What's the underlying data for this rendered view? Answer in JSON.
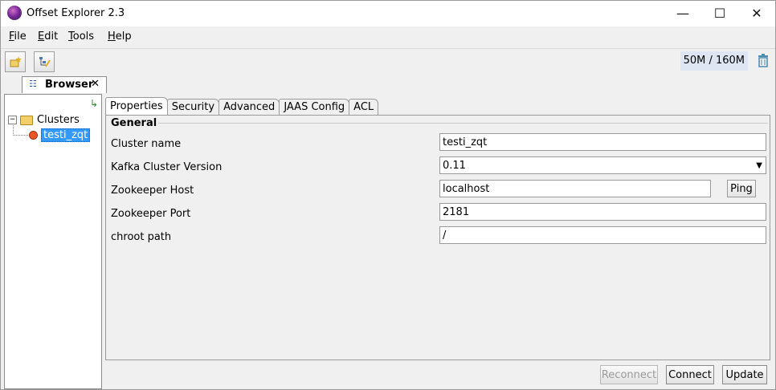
{
  "window": {
    "title": "Offset Explorer  2.3",
    "minimize": "—",
    "maximize": "☐",
    "close": "✕"
  },
  "menu": [
    {
      "mnemonic": "F",
      "rest": "ile"
    },
    {
      "mnemonic": "E",
      "rest": "dit"
    },
    {
      "mnemonic": "T",
      "rest": "ools"
    },
    {
      "mnemonic": "H",
      "rest": "elp"
    }
  ],
  "toolbar": {
    "memory": "50M / 160M",
    "icons": [
      "add-cluster-icon",
      "refresh-tree-icon",
      "trash-icon"
    ]
  },
  "browser_tab": {
    "label": "Browser",
    "close": "✕"
  },
  "tree": {
    "root": "Clusters",
    "expander": "−",
    "children": [
      "testi_zqt"
    ]
  },
  "tabs": [
    "Properties",
    "Security",
    "Advanced",
    "JAAS Config",
    "ACL"
  ],
  "general": {
    "group_title": "General",
    "rows": {
      "cluster_name": {
        "label": "Cluster name",
        "value": "testi_zqt"
      },
      "kafka_version": {
        "label": "Kafka Cluster Version",
        "value": "0.11"
      },
      "zk_host": {
        "label": "Zookeeper Host",
        "value": "localhost"
      },
      "zk_port": {
        "label": "Zookeeper Port",
        "value": "2181"
      },
      "chroot": {
        "label": "chroot path",
        "value": "/"
      }
    },
    "ping_label": "Ping"
  },
  "buttons": {
    "reconnect": "Reconnect",
    "connect": "Connect",
    "update": "Update"
  }
}
